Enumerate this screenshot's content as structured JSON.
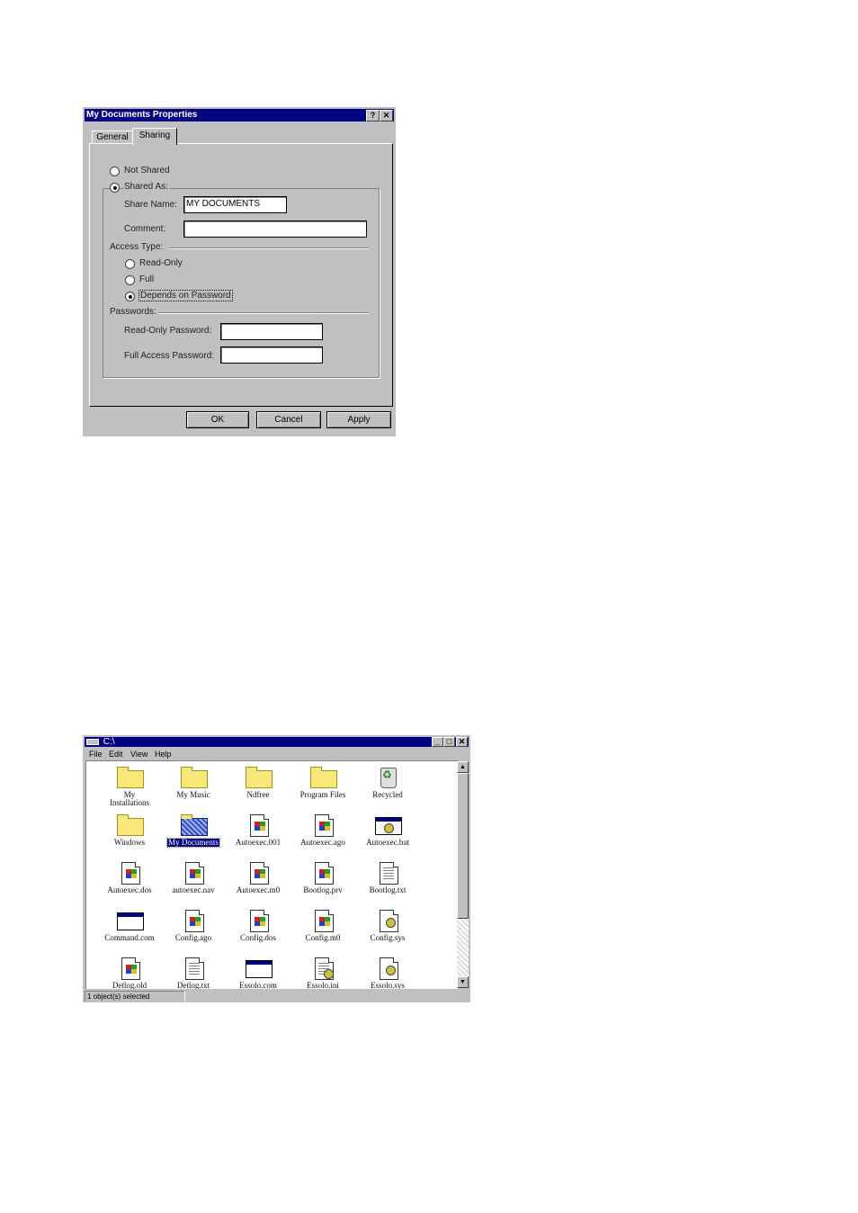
{
  "properties_dialog": {
    "title": "My Documents Properties",
    "help_btn": "?",
    "close_btn": "✕",
    "tabs": [
      {
        "label": "General"
      },
      {
        "label": "Sharing"
      }
    ],
    "not_shared": "Not Shared",
    "shared_as": "Shared As:",
    "share_name_label": "Share Name:",
    "share_name_value": "MY DOCUMENTS",
    "comment_label": "Comment:",
    "comment_value": "",
    "access_type_label": "Access Type:",
    "read_only": "Read-Only",
    "full": "Full",
    "depends": "Depends on Password",
    "passwords_label": "Passwords:",
    "read_only_password_label": "Read-Only Password:",
    "full_access_password_label": "Full Access Password:",
    "buttons": {
      "ok": "OK",
      "cancel": "Cancel",
      "apply": "Apply"
    }
  },
  "explorer": {
    "title": "C:\\",
    "minimize": "_",
    "maximize": "□",
    "close": "✕",
    "menu": [
      "File",
      "Edit",
      "View",
      "Help"
    ],
    "items": [
      {
        "label": "My Installations",
        "icon": "folder"
      },
      {
        "label": "My Music",
        "icon": "folder"
      },
      {
        "label": "Ndfree",
        "icon": "folder"
      },
      {
        "label": "Program Files",
        "icon": "folder"
      },
      {
        "label": "Recycled",
        "icon": "recycle-bin"
      },
      {
        "label": "Windows",
        "icon": "folder"
      },
      {
        "label": "My Documents",
        "icon": "shared-folder",
        "selected": true
      },
      {
        "label": "Autoexec.001",
        "icon": "windows-file"
      },
      {
        "label": "Autoexec.ago",
        "icon": "windows-file"
      },
      {
        "label": "Autoexec.bat",
        "icon": "batch-file"
      },
      {
        "label": "Autoexec.dos",
        "icon": "windows-file"
      },
      {
        "label": "autoexec.nav",
        "icon": "windows-file"
      },
      {
        "label": "Autoexec.m0",
        "icon": "windows-file"
      },
      {
        "label": "Bootlog.prv",
        "icon": "windows-file"
      },
      {
        "label": "Bootlog.txt",
        "icon": "text-file"
      },
      {
        "label": "Command.com",
        "icon": "application"
      },
      {
        "label": "Config.ago",
        "icon": "windows-file"
      },
      {
        "label": "Config.dos",
        "icon": "windows-file"
      },
      {
        "label": "Config.m0",
        "icon": "windows-file"
      },
      {
        "label": "Config.sys",
        "icon": "system-file"
      },
      {
        "label": "Detlog.old",
        "icon": "windows-file"
      },
      {
        "label": "Detlog.txt",
        "icon": "text-file"
      },
      {
        "label": "Essolo.com",
        "icon": "application"
      },
      {
        "label": "Essolo.ini",
        "icon": "ini-file"
      },
      {
        "label": "Essolo.sys",
        "icon": "system-file"
      }
    ],
    "status": "1 object(s) selected"
  }
}
